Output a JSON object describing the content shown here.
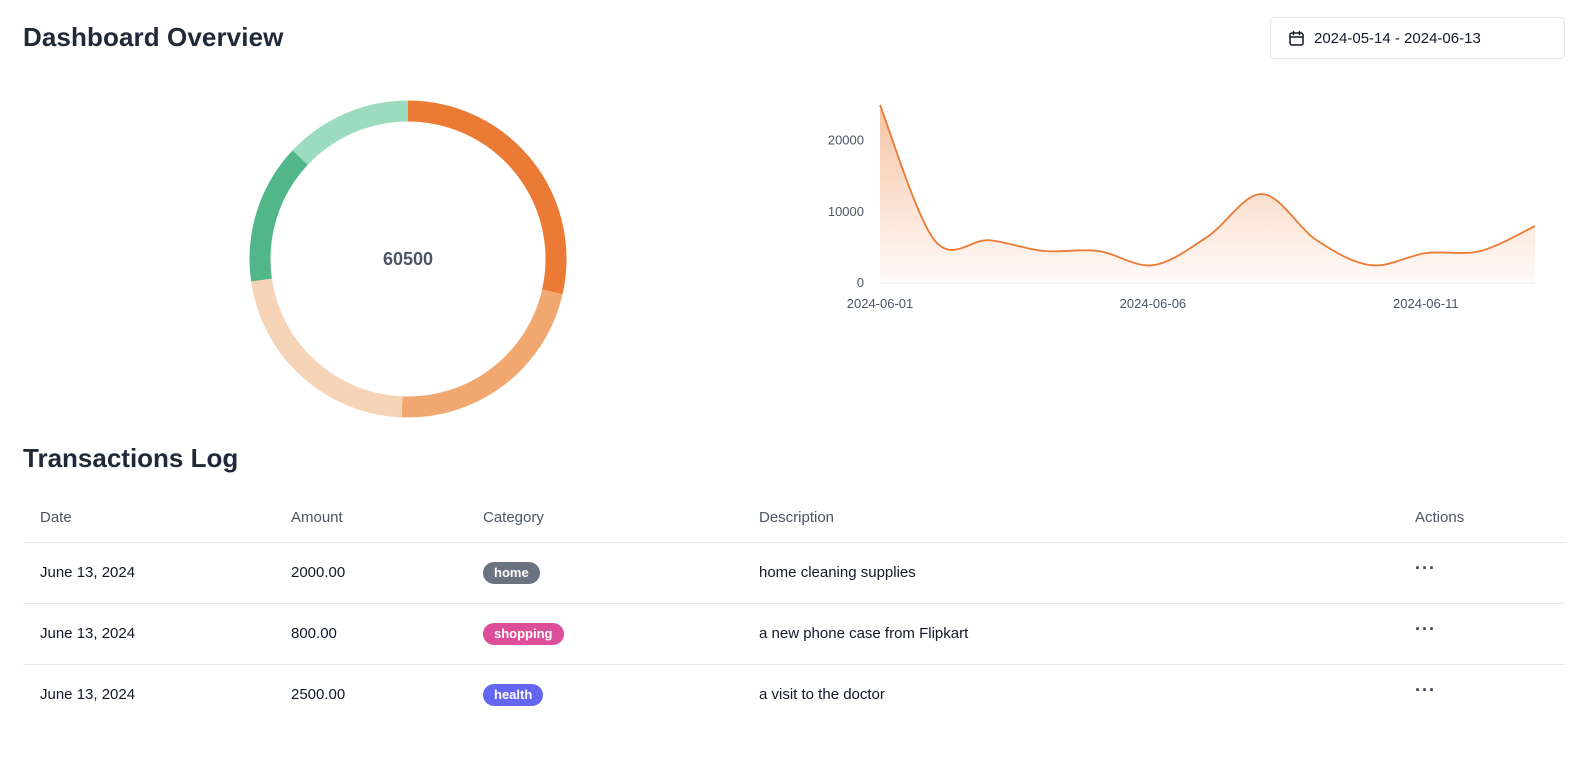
{
  "header": {
    "title": "Dashboard Overview",
    "date_range": "2024-05-14 - 2024-06-13",
    "date_icon": "calendar-icon"
  },
  "donut": {
    "total": "60500",
    "segments": [
      {
        "value": 22,
        "color": "#ea7a34"
      },
      {
        "value": 17,
        "color": "#f0a870"
      },
      {
        "value": 17,
        "color": "#f5d3b6"
      },
      {
        "value": 11,
        "color": "#52b788"
      },
      {
        "value": 10,
        "color": "#9bdbc0"
      }
    ]
  },
  "chart_data": {
    "type": "area",
    "x": [
      "2024-06-01",
      "2024-06-02",
      "2024-06-03",
      "2024-06-04",
      "2024-06-05",
      "2024-06-06",
      "2024-06-07",
      "2024-06-08",
      "2024-06-09",
      "2024-06-10",
      "2024-06-11",
      "2024-06-12",
      "2024-06-13"
    ],
    "values": [
      25000,
      6000,
      6000,
      4500,
      4500,
      2500,
      6500,
      12500,
      6000,
      2500,
      4200,
      4500,
      8000
    ],
    "ylim": [
      0,
      25000
    ],
    "yticks": [
      0,
      10000,
      20000
    ],
    "ytick_labels": [
      "0",
      "10000",
      "20000"
    ],
    "xtick_labels": [
      "2024-06-01",
      "2024-06-06",
      "2024-06-11"
    ],
    "xtick_index": [
      0,
      5,
      10
    ],
    "color": "#ea7a34",
    "grid": false
  },
  "transactions": {
    "title": "Transactions Log",
    "columns": [
      "Date",
      "Amount",
      "Category",
      "Description",
      "Actions"
    ],
    "rows": [
      {
        "date": "June 13, 2024",
        "amount": "2000.00",
        "category": "home",
        "category_color": "#6b7280",
        "description": "home cleaning supplies",
        "actions": "···"
      },
      {
        "date": "June 13, 2024",
        "amount": "800.00",
        "category": "shopping",
        "category_color": "#dc4d9a",
        "description": "a new phone case from Flipkart",
        "actions": "···"
      },
      {
        "date": "June 13, 2024",
        "amount": "2500.00",
        "category": "health",
        "category_color": "#6366f1",
        "description": "a visit to the doctor",
        "actions": "···"
      }
    ]
  }
}
